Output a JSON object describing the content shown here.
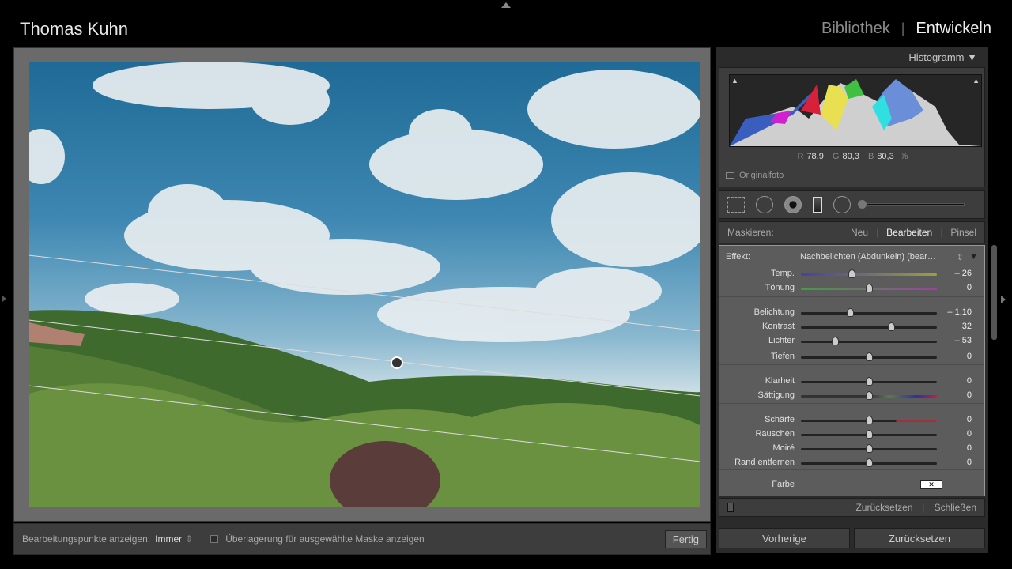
{
  "header": {
    "identity": "Thomas Kuhn",
    "modules": [
      "Bibliothek",
      "Entwickeln"
    ],
    "active_module": "Entwickeln",
    "separator": "|"
  },
  "histogram": {
    "title": "Histogramm",
    "r_label": "R",
    "r": "78,9",
    "g_label": "G",
    "g": "80,3",
    "b_label": "B",
    "b": "80,3",
    "unit": "%",
    "original_label": "Originalfoto"
  },
  "mask": {
    "label": "Maskieren:",
    "options": [
      "Neu",
      "Bearbeiten",
      "Pinsel"
    ],
    "active": "Bearbeiten"
  },
  "effect": {
    "label": "Effekt:",
    "value": "Nachbelichten (Abdunkeln) (bear…"
  },
  "sliders": [
    {
      "label": "Temp.",
      "value": "– 26",
      "pos": 0.37,
      "track": "linear-gradient(90deg,#4a3fa0,#9aa040)"
    },
    {
      "label": "Tönung",
      "value": "0",
      "pos": 0.5,
      "track": "linear-gradient(90deg,#3fa040,#a040a0)"
    },
    {
      "label": "Belichtung",
      "value": "– 1,10",
      "pos": 0.36
    },
    {
      "label": "Kontrast",
      "value": "32",
      "pos": 0.66
    },
    {
      "label": "Lichter",
      "value": "– 53",
      "pos": 0.25
    },
    {
      "label": "Tiefen",
      "value": "0",
      "pos": 0.5
    },
    {
      "label": "Klarheit",
      "value": "0",
      "pos": 0.5
    },
    {
      "label": "Sättigung",
      "value": "0",
      "pos": 0.5,
      "track": "linear-gradient(90deg,#333 50%,#5a7a50 65%,#3030a0 85%,#c02040)"
    },
    {
      "label": "Schärfe",
      "value": "0",
      "pos": 0.5,
      "track": "linear-gradient(90deg,#222 70%,#a03040 70%)"
    },
    {
      "label": "Rauschen",
      "value": "0",
      "pos": 0.5
    },
    {
      "label": "Moiré",
      "value": "0",
      "pos": 0.5
    },
    {
      "label": "Rand entfernen",
      "value": "0",
      "pos": 0.5
    }
  ],
  "color_label": "Farbe",
  "panel_footer": {
    "reset": "Zurücksetzen",
    "close": "Schließen"
  },
  "buttons": {
    "previous": "Vorherige",
    "reset": "Zurücksetzen"
  },
  "toolbar": {
    "show_points_label": "Bearbeitungspunkte anzeigen:",
    "show_points_value": "Immer",
    "overlay_label": "Überlagerung für ausgewählte Maske anzeigen",
    "done": "Fertig"
  }
}
